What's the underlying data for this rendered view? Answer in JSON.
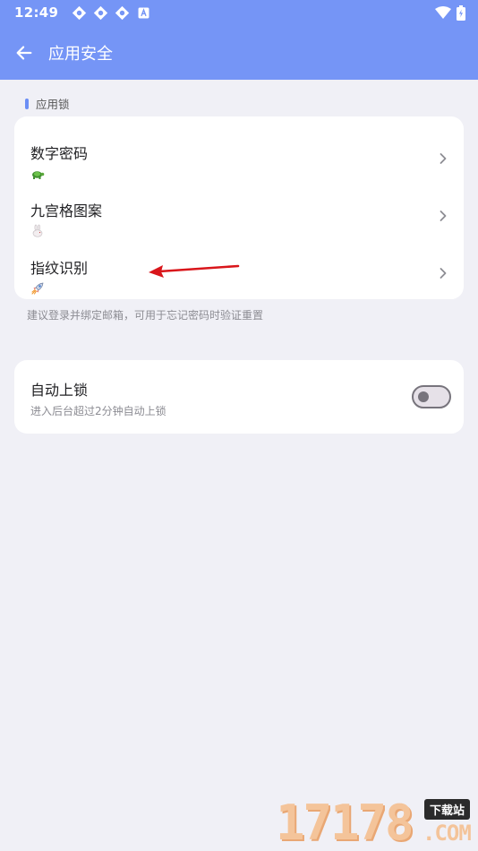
{
  "status_bar": {
    "time": "12:49",
    "notification_icons": [
      "sync-icon",
      "sync-icon",
      "sync-icon",
      "text-app-icon"
    ],
    "wifi_icon": "wifi-icon",
    "battery_icon": "battery-charging-icon"
  },
  "app_bar": {
    "title": "应用安全",
    "back_icon": "arrow-left-icon",
    "color": "#7595f6"
  },
  "lock_section": {
    "header": "应用锁",
    "items": [
      {
        "title": "数字密码",
        "icon": "turtle-icon"
      },
      {
        "title": "九宫格图案",
        "icon": "rabbit-icon"
      },
      {
        "title": "指纹识别",
        "icon": "rocket-icon"
      }
    ],
    "hint": "建议登录并绑定邮箱，可用于忘记密码时验证重置"
  },
  "auto_lock": {
    "title": "自动上锁",
    "subtitle": "进入后台超过2分钟自动上锁",
    "enabled": false
  },
  "annotation": {
    "arrow_color": "#d9161b"
  },
  "watermark": {
    "digits": "17178",
    "badge": "下载站",
    "suffix": ".COM"
  },
  "colors": {
    "accent": "#7595f6",
    "background": "#f0f0f6",
    "card": "#ffffff"
  }
}
